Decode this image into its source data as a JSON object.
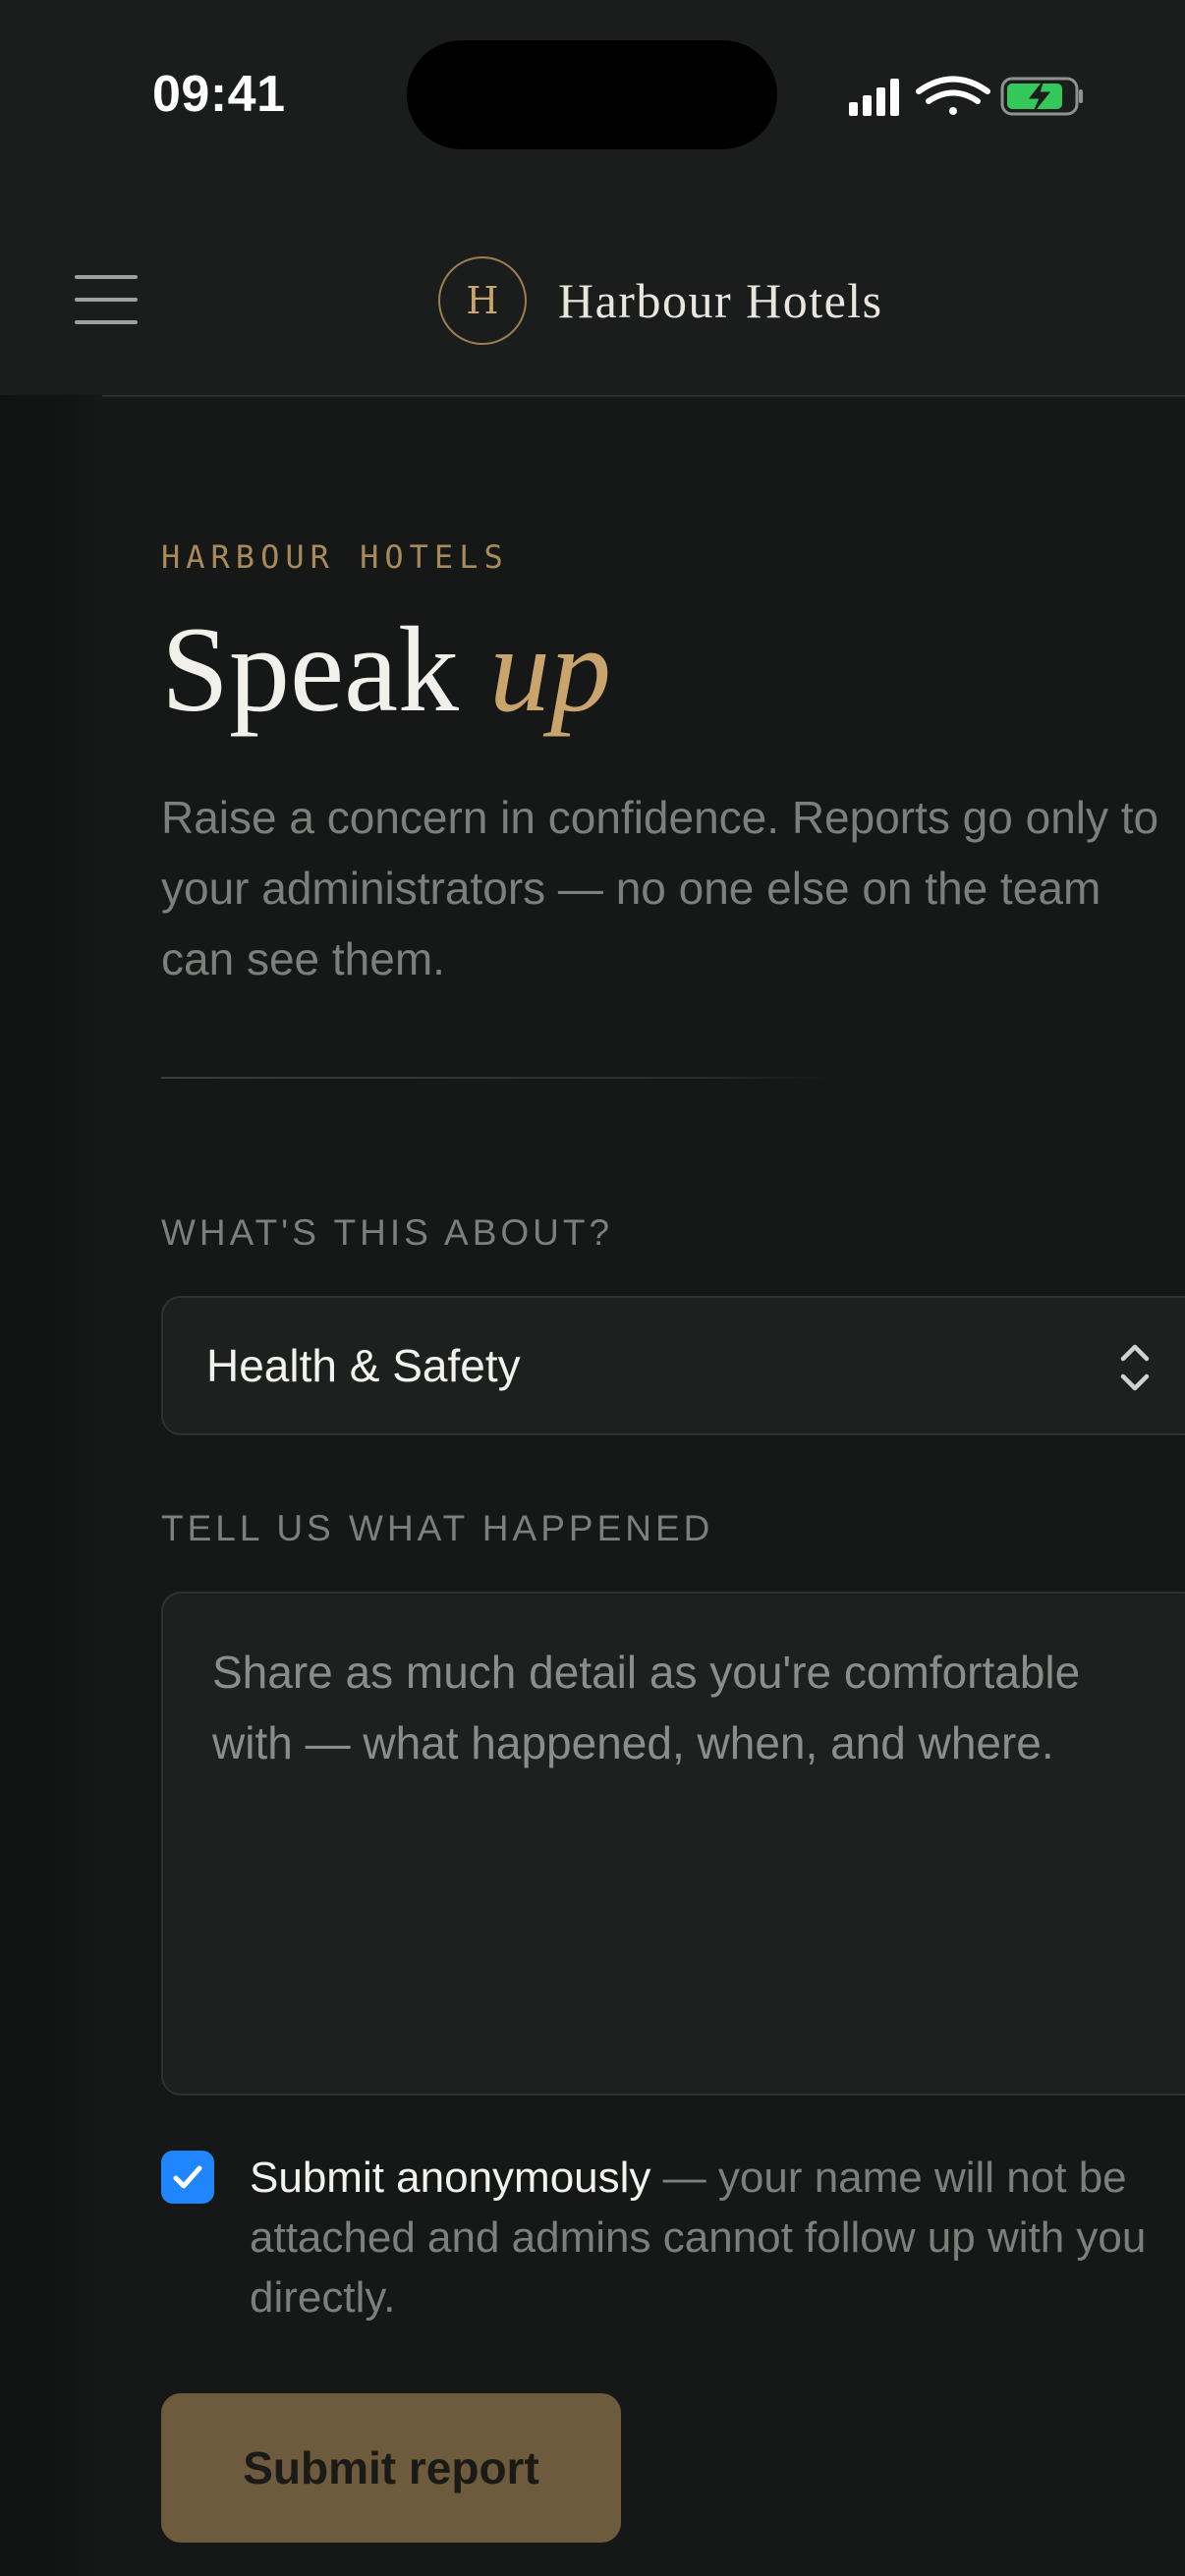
{
  "status_bar": {
    "time": "09:41",
    "battery_color": "#34c759"
  },
  "header": {
    "logo_letter": "H",
    "brand_name": "Harbour Hotels"
  },
  "form": {
    "eyebrow": "HARBOUR HOTELS",
    "title_main": "Speak",
    "title_accent": "up",
    "intro": "Raise a concern in confidence. Reports go only to your administrators — no one else on the team can see them.",
    "topic_label": "WHAT'S THIS ABOUT?",
    "topic_value": "Health & Safety",
    "details_label": "TELL US WHAT HAPPENED",
    "details_placeholder": "Share as much detail as you're comfortable with — what happened, when, and where.",
    "anonymous": {
      "checked": true,
      "label": "Submit anonymously",
      "hint": " — your name will not be attached and admins cannot follow up with you directly."
    },
    "submit_label": "Submit report"
  },
  "colors": {
    "accent_gold": "#c9a46c",
    "checkbox_blue": "#1f86ff",
    "button_bg": "#6e5a3c"
  }
}
